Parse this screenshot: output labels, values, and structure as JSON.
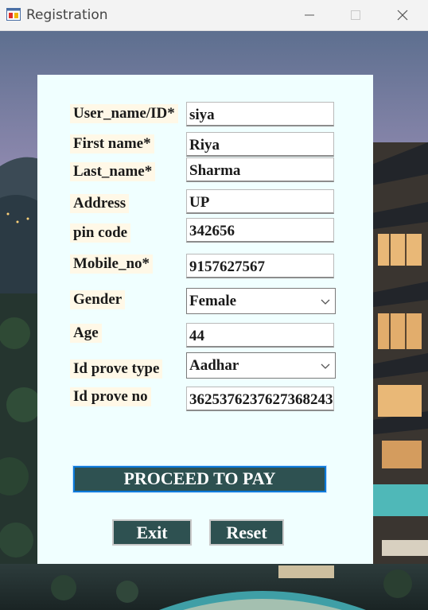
{
  "window": {
    "title": "Registration"
  },
  "form": {
    "user_id": {
      "label": "User_name/ID*",
      "value": "siya"
    },
    "first_name": {
      "label": "First name*",
      "value": "Riya"
    },
    "last_name": {
      "label": "Last_name*",
      "value": "Sharma"
    },
    "address": {
      "label": "Address",
      "value": "UP"
    },
    "pin_code": {
      "label": "pin code",
      "value": "342656"
    },
    "mobile_no": {
      "label": "Mobile_no*",
      "value": "9157627567"
    },
    "gender": {
      "label": "Gender",
      "value": "Female"
    },
    "age": {
      "label": "Age",
      "value": "44"
    },
    "id_prove_type": {
      "label": "Id prove type",
      "value": "Aadhar"
    },
    "id_prove_no": {
      "label": "Id prove no",
      "value": "3625376237627368243"
    }
  },
  "buttons": {
    "proceed": "PROCEED TO PAY",
    "exit": "Exit",
    "reset": "Reset"
  },
  "icons": {
    "app": "registration-app-icon",
    "minimize": "minimize-icon",
    "maximize": "maximize-icon",
    "close": "close-icon",
    "dropdown": "chevron-down-icon"
  },
  "colors": {
    "panel": "#f0ffff",
    "button": "#2e5151",
    "label_bg": "#fff8e7"
  }
}
